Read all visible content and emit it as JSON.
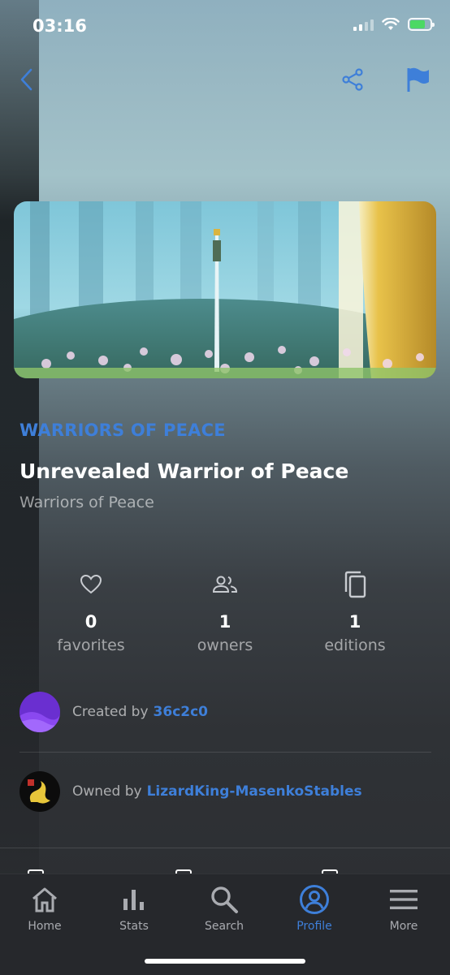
{
  "status_bar": {
    "time": "03:16"
  },
  "header": {
    "back_icon": "chevron-left-icon",
    "share_icon": "share-icon",
    "flag_icon": "flag-icon",
    "accent_color": "#3e7fd9"
  },
  "item": {
    "collection_label": "WARRIORS OF PEACE",
    "title": "Unrevealed Warrior of Peace",
    "subtitle": "Warriors of Peace"
  },
  "stats": [
    {
      "icon": "heart-icon",
      "value": "0",
      "label": "favorites"
    },
    {
      "icon": "people-icon",
      "value": "1",
      "label": "owners"
    },
    {
      "icon": "copy-icon",
      "value": "1",
      "label": "editions"
    }
  ],
  "creator": {
    "prefix": "Created by",
    "name": "36c2c0"
  },
  "owner": {
    "prefix": "Owned by",
    "name": "LizardKing-MasenkoStables"
  },
  "tab_bar": {
    "items": [
      {
        "label": "Home",
        "icon": "home-icon"
      },
      {
        "label": "Stats",
        "icon": "bar-chart-icon"
      },
      {
        "label": "Search",
        "icon": "search-icon"
      },
      {
        "label": "Profile",
        "icon": "profile-icon",
        "active": true
      },
      {
        "label": "More",
        "icon": "menu-icon"
      }
    ],
    "active_color": "#3e7fd9"
  }
}
